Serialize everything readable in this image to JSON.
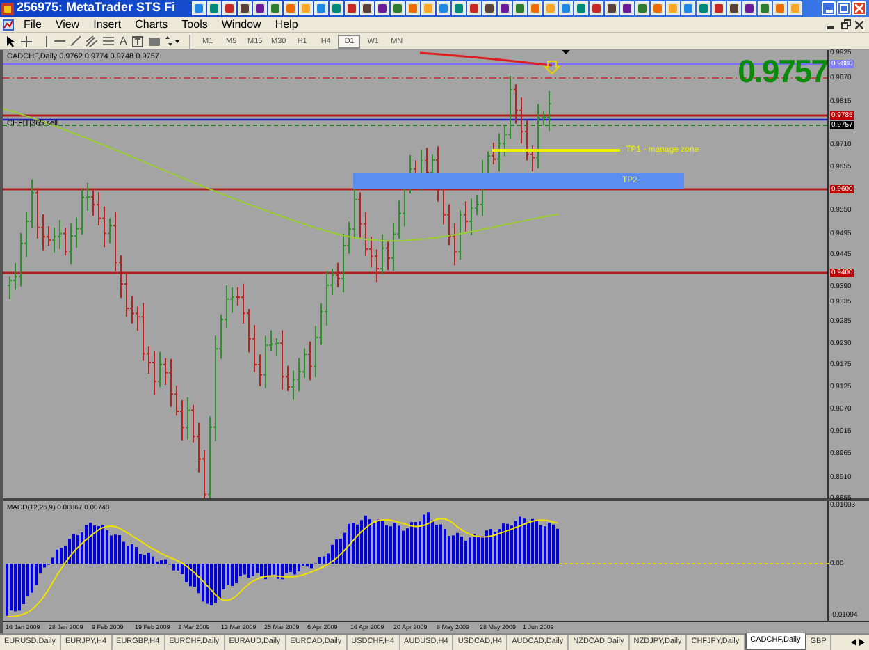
{
  "window": {
    "title": "256975: MetaTrader STS Fi"
  },
  "menu": [
    "File",
    "View",
    "Insert",
    "Charts",
    "Tools",
    "Window",
    "Help"
  ],
  "toolbar": {
    "text_tool": "A",
    "timeframes": [
      {
        "label": "M1",
        "selected": false
      },
      {
        "label": "M5",
        "selected": false
      },
      {
        "label": "M15",
        "selected": false
      },
      {
        "label": "M30",
        "selected": false
      },
      {
        "label": "H1",
        "selected": false
      },
      {
        "label": "H4",
        "selected": false
      },
      {
        "label": "D1",
        "selected": true
      },
      {
        "label": "W1",
        "selected": false
      },
      {
        "label": "MN",
        "selected": false
      }
    ]
  },
  "chart": {
    "info": "CADCHF,Daily  0.9762 0.9774 0.9748 0.9757",
    "bid": "0.9757",
    "line_label": "CHF|T|365 sell",
    "objects": [
      {
        "kind": "line",
        "label": "TP1 - manage zone"
      },
      {
        "kind": "zone",
        "label": "TP2"
      }
    ],
    "price_axis": [
      "0.9925",
      "0.9870",
      "0.9815",
      "0.9710",
      "0.9655",
      "0.9550",
      "0.9495",
      "0.9445",
      "0.9390",
      "0.9335",
      "0.9285",
      "0.9230",
      "0.9175",
      "0.9125",
      "0.9070",
      "0.9015",
      "0.8965",
      "0.8910",
      "0.8855"
    ],
    "price_markers": [
      {
        "text": "0.9880",
        "color": "#8080ff"
      },
      {
        "text": "0.9785",
        "color": "#c00000"
      },
      {
        "text": "0.9757",
        "color": "#000000"
      },
      {
        "text": "0.9600",
        "color": "#c00000"
      },
      {
        "text": "0.9400",
        "color": "#c00000"
      }
    ]
  },
  "indicator": {
    "label": "MACD(12,26,9) 0.00867 0.00748",
    "axis": [
      "0.01003",
      "0.00",
      "-0.01094"
    ]
  },
  "time_axis": [
    "16 Jan 2009",
    "28 Jan 2009",
    "9 Feb 2009",
    "19 Feb 2009",
    "3 Mar 2009",
    "13 Mar 2009",
    "25 Mar 2009",
    "6 Apr 2009",
    "16 Apr 2009",
    "20 Apr 2009",
    "8 May 2009",
    "28 May 2009",
    "1 Jun 2009"
  ],
  "tabs": [
    {
      "label": "EURUSD,Daily",
      "selected": false
    },
    {
      "label": "EURJPY,H4",
      "selected": false
    },
    {
      "label": "EURGBP,H4",
      "selected": false
    },
    {
      "label": "EURCHF,Daily",
      "selected": false
    },
    {
      "label": "EURAUD,Daily",
      "selected": false
    },
    {
      "label": "EURCAD,Daily",
      "selected": false
    },
    {
      "label": "USDCHF,H4",
      "selected": false
    },
    {
      "label": "AUDUSD,H4",
      "selected": false
    },
    {
      "label": "USDCAD,H4",
      "selected": false
    },
    {
      "label": "AUDCAD,Daily",
      "selected": false
    },
    {
      "label": "NZDCAD,Daily",
      "selected": false
    },
    {
      "label": "NZDJPY,Daily",
      "selected": false
    },
    {
      "label": "CHFJPY,Daily",
      "selected": false
    },
    {
      "label": "CADCHF,Daily",
      "selected": true
    },
    {
      "label": "GBP",
      "selected": false
    }
  ]
}
